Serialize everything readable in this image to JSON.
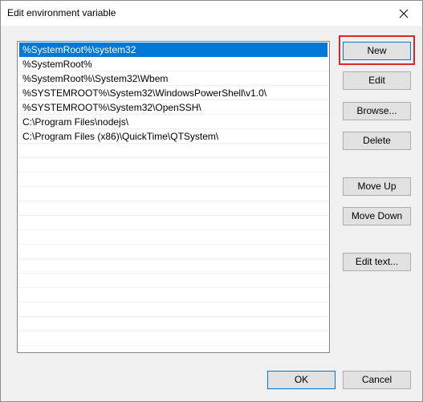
{
  "window": {
    "title": "Edit environment variable",
    "close_icon": "close-icon"
  },
  "list": {
    "items": [
      "%SystemRoot%\\system32",
      "%SystemRoot%",
      "%SystemRoot%\\System32\\Wbem",
      "%SYSTEMROOT%\\System32\\WindowsPowerShell\\v1.0\\",
      "%SYSTEMROOT%\\System32\\OpenSSH\\",
      "C:\\Program Files\\nodejs\\",
      "C:\\Program Files (x86)\\QuickTime\\QTSystem\\"
    ],
    "selected_index": 0,
    "empty_rows": 14
  },
  "buttons": {
    "new": "New",
    "edit": "Edit",
    "browse": "Browse...",
    "delete": "Delete",
    "move_up": "Move Up",
    "move_down": "Move Down",
    "edit_text": "Edit text...",
    "ok": "OK",
    "cancel": "Cancel"
  },
  "colors": {
    "selection": "#0078d7",
    "highlight": "#d9262a"
  }
}
